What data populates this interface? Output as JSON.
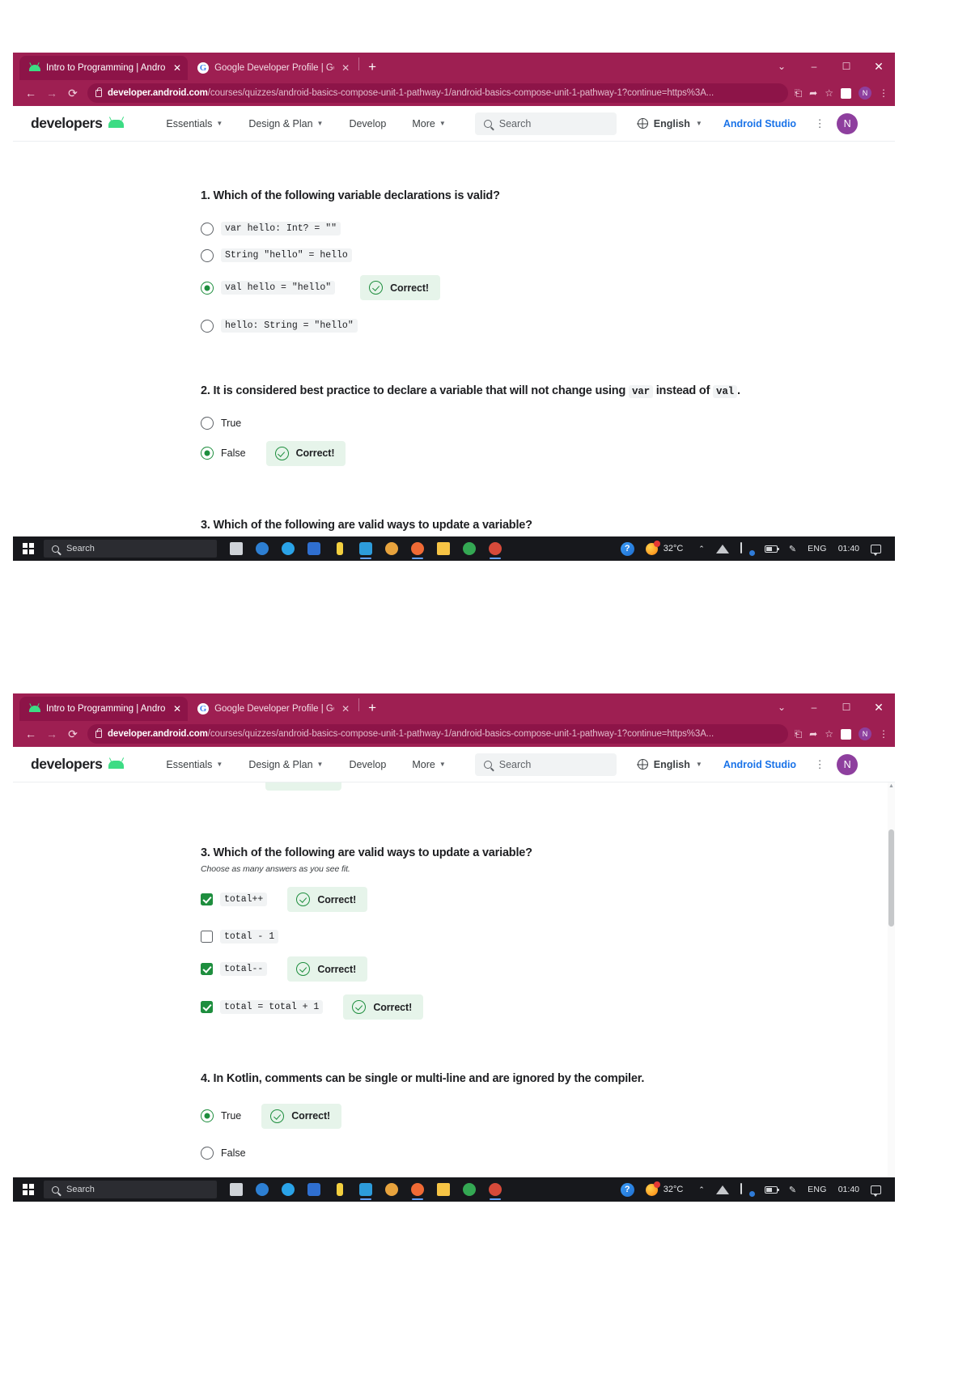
{
  "browser": {
    "tabs": [
      {
        "title": "Intro to Programming  |  Android",
        "favicon": "android-icon",
        "active": true,
        "close_label": "✕"
      },
      {
        "title": "Google Developer Profile  |  Goo",
        "favicon": "google-g-icon",
        "active": false,
        "close_label": "✕"
      }
    ],
    "new_tab_label": "+",
    "window_controls": {
      "minimize_dropdown": "⌄",
      "minimize": "–",
      "maximize": "☐",
      "close": "✕"
    },
    "nav": {
      "back": "←",
      "forward": "→",
      "reload": "⟳"
    },
    "url_domain": "developer.android.com",
    "url_path": "/courses/quizzes/android-basics-compose-unit-1-pathway-1/android-basics-compose-unit-1-pathway-1?continue=https%3A...",
    "omnibox_icons": [
      "install-icon",
      "share-icon",
      "bookmark-star-icon",
      "extension-icon",
      "profile-avatar",
      "chrome-menu-icon"
    ],
    "profile_initial": "N"
  },
  "site_header": {
    "brand": "developers",
    "brand_icon": "android-logo-icon",
    "nav_items": [
      {
        "label": "Essentials",
        "has_caret": true
      },
      {
        "label": "Design & Plan",
        "has_caret": true
      },
      {
        "label": "Develop",
        "has_caret": false
      },
      {
        "label": "More",
        "has_caret": true
      }
    ],
    "search_placeholder": "Search",
    "language": "English",
    "studio_link": "Android Studio",
    "kebab": "⋮",
    "avatar_initial": "N"
  },
  "correct_badge": {
    "label": "Correct!",
    "icon": "check-circle-icon",
    "bg": "#e6f4ea",
    "fg": "#1e8e3e"
  },
  "quiz": {
    "questions": [
      {
        "number": "1.",
        "text": "Which of the following variable declarations is valid?",
        "subtitle": "",
        "type": "radio",
        "options": [
          {
            "code": "var hello: Int? = \"\"",
            "selected": false,
            "correct": false
          },
          {
            "code": "String \"hello\" = hello",
            "selected": false,
            "correct": false
          },
          {
            "code": "val hello = \"hello\"",
            "selected": true,
            "correct": true
          },
          {
            "code": "hello: String = \"hello\"",
            "selected": false,
            "correct": false
          }
        ]
      },
      {
        "number": "2.",
        "text_part1": "It is considered best practice to declare a variable that will not change using",
        "code1": "var",
        "text_part2": "instead of",
        "code2": "val",
        "text_part3": ".",
        "type": "radio",
        "options": [
          {
            "label": "True",
            "selected": false,
            "correct": false
          },
          {
            "label": "False",
            "selected": true,
            "correct": true
          }
        ]
      },
      {
        "number": "3.",
        "text": "Which of the following are valid ways to update a variable?",
        "subtitle": "Choose as many answers as you see fit.",
        "type": "checkbox",
        "options": [
          {
            "code": "total++",
            "checked": true,
            "correct": true
          },
          {
            "code": "total - 1",
            "checked": false,
            "correct": false
          },
          {
            "code": "total--",
            "checked": true,
            "correct": true
          },
          {
            "code": "total = total + 1",
            "checked": true,
            "correct": true
          }
        ]
      },
      {
        "number": "4.",
        "text": "In Kotlin, comments can be single or multi-line and are ignored by the compiler.",
        "subtitle": "",
        "type": "radio",
        "options": [
          {
            "label": "True",
            "selected": true,
            "correct": true
          },
          {
            "label": "False",
            "selected": false,
            "correct": false
          }
        ]
      }
    ]
  },
  "taskbar": {
    "start_label": "windows-start-icon",
    "search_placeholder": "Search",
    "pinned": [
      {
        "name": "task-view-icon",
        "color": "#cfd3d8"
      },
      {
        "name": "edge-icon",
        "color": "#2d7fd3"
      },
      {
        "name": "chrome-icon",
        "color": "#2aa3e8"
      },
      {
        "name": "mail-icon",
        "color": "#2f6fd0"
      },
      {
        "name": "lightning-icon",
        "color": "#f4d03f"
      },
      {
        "name": "store-icon",
        "color": "#2d9cdb"
      },
      {
        "name": "office-icon",
        "color": "#e8a33d"
      },
      {
        "name": "brave-icon",
        "color": "#f06a35"
      },
      {
        "name": "explorer-icon",
        "color": "#f6c445"
      },
      {
        "name": "chrome-window-icon",
        "color": "#34a853"
      },
      {
        "name": "chrome-active-icon",
        "color": "#d64a3a"
      }
    ],
    "help_icon": "help-circle-icon",
    "weather_temp": "32°C",
    "weather_icon": "sun-cloud-icon",
    "tray_expand": "⌃",
    "tray_icons": [
      "wifi-icon",
      "display-icon",
      "battery-icon",
      "pen-icon"
    ],
    "language": "ENG",
    "clock": "01:40",
    "notifications": "notification-icon"
  }
}
